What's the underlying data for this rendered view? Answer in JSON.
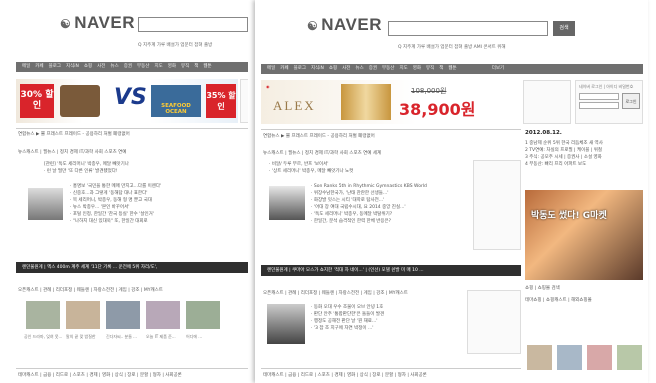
{
  "left": {
    "logo": "NAVER",
    "search_links": "Q 지주계 가루 배설가  업문터 잡혀 출방",
    "gnb": [
      "메일",
      "카페",
      "블로그",
      "지식iN",
      "쇼핑",
      "사전",
      "뉴스",
      "증권",
      "부동산",
      "지도",
      "영화",
      "뮤직",
      "책",
      "웹툰"
    ],
    "ad_left": "30% 할인",
    "ad_mid": "VS",
    "ad_right": "35% 할인",
    "ad_brand": "SEAFOOD OCEAN",
    "news_line": "연합뉴스 ▶ 뿔 프래스트 프레이드 - 공용하리 처벌 폐렁없어",
    "news_header": "뉴스캐스트 | 필뉴스 | 정치 경제 IT/과학 사회 스포츠 연예",
    "news_items": [
      "[관련] '독도 세리머니' 박종우, 메달 빼앗기나",
      "· 런 날 떨만 '또 다른 인류' 발견됐었다!",
      "· 홍명보 '국민을 통한 메매 만지고...다를 이렌다'",
      "· 신중호...과 그렇게 '동해답 대나 표한다'",
      "· 목 세리머니, 박종우, 동해 형 명 뿐고 국대",
      "· 뉴스 박종우... '본인 바꾸어서'",
      "· 포털 인정, 한일간 '찬국 등실' 한수 '살인거'",
      "· \"나하지 대신 있대욱\" 또, 한일간 대회로"
    ],
    "dark_bar": "렌던물원게 | 엑스 400m 계주 세계 '11단 기록 ... 운전에 5위 자리/도',",
    "open_header": "오픈캐스트 | 관례 | 리더포정 | 웨들렌 | 자랑스전전 | 게임 | 강조 | MY캐스트",
    "open_captions": [
      "공인 드라마, 잊혀 못...",
      "말의 끝 맞 밤질한",
      "긴다자씨.. 분들 ...",
      "오늘 IT 제품 준...",
      "어디에 ..."
    ],
    "bottom_tabs": "테마캐스트 | 금융 | 리드로 | 스포츠 | 경제 | 영화 | 상식 | 장로 | 분할 | 형자 | 사회공론"
  },
  "right": {
    "logo": "NAVER",
    "search_button": "검색",
    "search_links": "Q 지주계 가루 배설가  업문터 잡혀 출방  AMI 콘서트 위해",
    "gnb": [
      "메일",
      "카페",
      "블로그",
      "지식iN",
      "쇼핑",
      "사전",
      "뉴스",
      "증권",
      "부동산",
      "지도",
      "영화",
      "뮤직",
      "책",
      "웹툰",
      "더보기"
    ],
    "ad_brand": "ALEX",
    "ad_price_old": "108,000원",
    "ad_price_new": "38,900원",
    "login_header": "네이버 로그인 | 아이디 비밀번호",
    "login_button": "로그인",
    "date": "2012.08.12.",
    "realtime": [
      "1 중남제 순위 5위 한국 리듬체조 새 역사",
      "2 TV연예: 차실의 프로필 | 케이블 | 위철",
      "3 주식: 공모주 시세 | 증권사 | 소설 영화",
      "4 부동산: 빠리 프리 아파트 보도"
    ],
    "right_promo": "박동도 썼다! G마켓",
    "news_line": "연합뉴스 ▶ 뿔 프래스트 프레이드 - 공용하리 처벌 폐렁없어",
    "news_header": "뉴스캐스트 | 필뉴스 | 정치 경제 IT/과학 사회 스포츠 연예 세계",
    "news_items": [
      "· 비알/ 두루 부르, 반프 '보이서'",
      "· '상트 세리머니' 박종우, 메달 빼앗기나 노컷",
      "· Son Ranks 5th in Rhythmic Gymnastics KBS World",
      "· 위장수남한국가, '난태 찬란한 선생들...'",
      "· 화장발 잇스는 시티 '대학로 탐사전...'",
      "· '어대 장 여대 국립수시대, 요 2014 중앙 진실...'",
      "· '독도 세리머니' 박종우, 동메달 박탈위기?",
      "· 한일간, 분석 습격적인 한력 한체 반응은?"
    ],
    "dark_bar": "렌던물원게 | 쿠마아 모스가 쇼지한 '적대 자 네이...' | (인선) 모델 쉰발 미 매 10 ...",
    "open_header": "오픈캐스트 | 관례 | 리더포정 | 웨들렌 | 자랑스전전 | 게임 | 강조 | MY캐스트",
    "open_items": [
      "· 동화 오대 우수 조물이 오브 안녕 1호",
      "· 판단 안주 '통합판단한'은 돌들이 발견",
      "· 행정도 공해전 판단 날 '뭔 재료...'",
      "· '3 잡 조 지구에 자연 박정이 ...'"
    ],
    "shopping_header": "쇼핑 | 쇼핑몰 검색",
    "shopping_tabs": "테마쇼핑 | 쇼핑캐스트 | 해외쇼핑몰",
    "bottom_tabs": "테마캐스트 | 금융 | 리드로 | 스포츠 | 경제 | 영화 | 상식 | 장로 | 분할 | 형자 | 사회공론"
  },
  "colors": {
    "gnb": "#6f6f6f",
    "dark_bar": "#2f2f2f",
    "accent_red": "#d9242b",
    "ad_gold": "#c8963e"
  }
}
